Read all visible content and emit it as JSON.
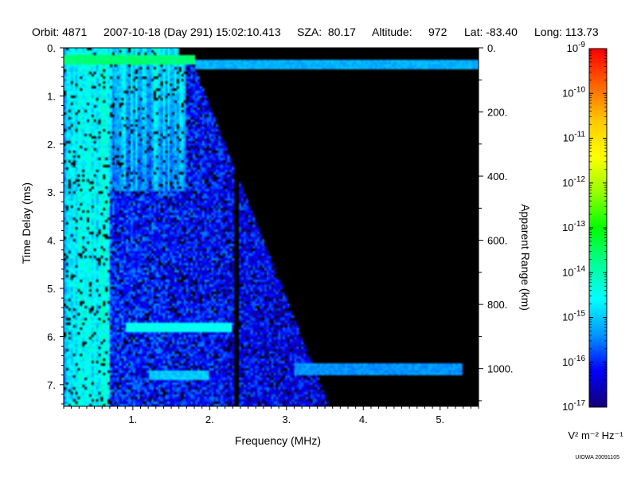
{
  "header": {
    "orbit": "Orbit: 4871",
    "datetime": "2007-10-18 (Day 291) 15:02:10.413",
    "sza": "SZA:  80.17",
    "altitude_label": "Altitude:",
    "altitude_value": "972",
    "lat": "Lat: -83.40",
    "long": "Long: 113.73"
  },
  "footnote": "UIOWA 20091105",
  "chart_data": {
    "type": "heatmap",
    "xlabel": "Frequency (MHz)",
    "ylabel": "Time Delay (ms)",
    "y2label": "Apparent Range (km)",
    "xlim": [
      0.1,
      5.5
    ],
    "ylim": [
      0,
      7.45
    ],
    "x_ticks": [
      1,
      2,
      3,
      4,
      5
    ],
    "x_tick_labels": [
      "1.",
      "2.",
      "3.",
      "4.",
      "5."
    ],
    "y_ticks": [
      0,
      1,
      2,
      3,
      4,
      5,
      6,
      7
    ],
    "y_tick_labels": [
      "0.",
      "1.",
      "2.",
      "3.",
      "4.",
      "5.",
      "6.",
      "7."
    ],
    "y2_ticks": [
      0,
      200,
      400,
      600,
      800,
      1000
    ],
    "y2_tick_labels": [
      "0.",
      "200.",
      "400.",
      "600.",
      "800.",
      "1000."
    ],
    "y2_km_per_ms": 150,
    "colorbar": {
      "unit_label": "V² m⁻² Hz⁻¹",
      "log_range": [
        -17,
        -9
      ],
      "tick_exponents": [
        -9,
        -10,
        -11,
        -12,
        -13,
        -14,
        -15,
        -16,
        -17
      ],
      "colors": [
        "#140078",
        "#0000ff",
        "#0096ff",
        "#00ffff",
        "#00ff96",
        "#00ff00",
        "#96ff00",
        "#ffff00",
        "#ffc800",
        "#ff6400",
        "#ff0000"
      ]
    },
    "features": {
      "surface_echo": [
        {
          "x": [
            0.1,
            1.8
          ],
          "y": 0.25,
          "level": -13.6
        },
        {
          "x": [
            1.8,
            5.5
          ],
          "y": 0.35,
          "level": -15.2
        }
      ],
      "echo_lines": [
        {
          "x": [
            0.9,
            2.3
          ],
          "y": 5.8,
          "level": -14.5
        },
        {
          "x": [
            3.1,
            5.3
          ],
          "y": 6.68,
          "level": -15.4
        },
        {
          "x": [
            1.2,
            2.0
          ],
          "y": 6.8,
          "level": -15.0
        }
      ],
      "dark_column_mhz": 2.35,
      "noise_boundary_mhz": 5.5,
      "seed": 4871
    }
  }
}
